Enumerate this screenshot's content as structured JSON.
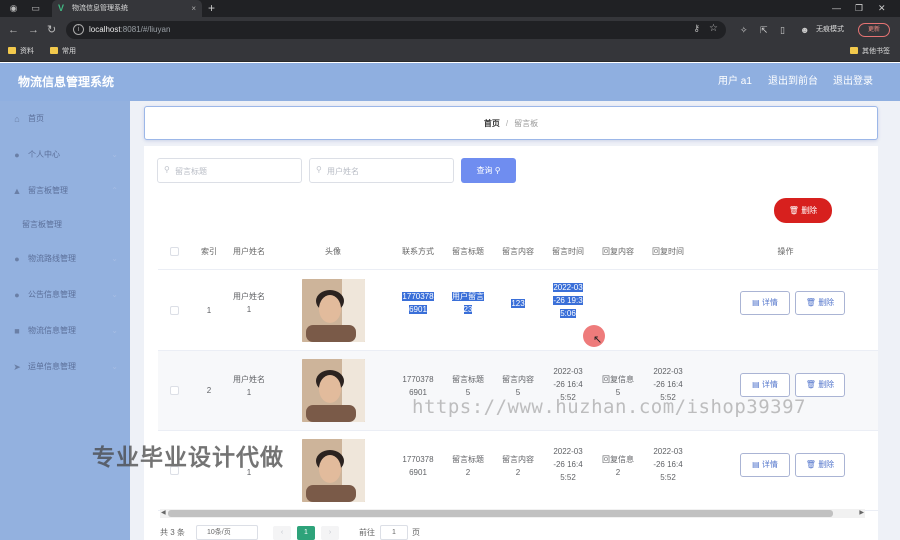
{
  "browser": {
    "tab_title": "物流信息管理系统",
    "tab_close": "×",
    "new_tab": "+",
    "url_host": "localhost",
    "url_rest": ":8081/#/liuyan",
    "incognito_label": "无痕模式",
    "update_label": "更新",
    "bookmarks": [
      "资料",
      "常用"
    ],
    "other_bookmarks": "其他书签"
  },
  "app": {
    "title": "物流信息管理系统",
    "user_label": "用户 a1",
    "back_label": "退出到前台",
    "logout_label": "退出登录"
  },
  "sidebar": {
    "items": [
      {
        "label": "首页",
        "icon": "home-icon"
      },
      {
        "label": "个人中心",
        "icon": "user-icon"
      },
      {
        "label": "留言板管理",
        "icon": "message-icon"
      },
      {
        "label": "留言板管理",
        "icon": ""
      },
      {
        "label": "物流路线管理",
        "icon": "user-icon"
      },
      {
        "label": "公告信息管理",
        "icon": "user-icon"
      },
      {
        "label": "物流信息管理",
        "icon": "box-icon"
      },
      {
        "label": "运单信息管理",
        "icon": "send-icon"
      }
    ]
  },
  "breadcrumb": {
    "home": "首页",
    "separator": "/",
    "current": "留言板"
  },
  "search": {
    "title_placeholder": "留言标题",
    "username_placeholder": "用户姓名",
    "query_label": "查询",
    "delete_label": "删除"
  },
  "table": {
    "headers": [
      "索引",
      "用户姓名",
      "头像",
      "联系方式",
      "留言标题",
      "留言内容",
      "留言时间",
      "回复内容",
      "回复时间",
      "操作"
    ],
    "rows": [
      {
        "index": "1",
        "username": [
          "用户姓名",
          "1"
        ],
        "phone": [
          "1770378",
          "6901"
        ],
        "title": [
          "用户留言",
          "23"
        ],
        "content": [
          "123"
        ],
        "time": [
          "2022-03",
          "-26 19:3",
          "5:06"
        ],
        "reply": [],
        "reply_time": []
      },
      {
        "index": "2",
        "username": [
          "用户姓名",
          "1"
        ],
        "phone": [
          "1770378",
          "6901"
        ],
        "title": [
          "留言标题",
          "5"
        ],
        "content": [
          "留言内容",
          "5"
        ],
        "time": [
          "2022-03",
          "-26 16:4",
          "5:52"
        ],
        "reply": [
          "回复信息",
          "5"
        ],
        "reply_time": [
          "2022-03",
          "-26 16:4",
          "5:52"
        ]
      },
      {
        "index": "",
        "username": [
          "",
          "1"
        ],
        "phone": [
          "1770378",
          "6901"
        ],
        "title": [
          "留言标题",
          "2"
        ],
        "content": [
          "留言内容",
          "2"
        ],
        "time": [
          "2022-03",
          "-26 16:4",
          "5:52"
        ],
        "reply": [
          "回复信息",
          "2"
        ],
        "reply_time": [
          "2022-03",
          "-26 16:4",
          "5:52"
        ]
      }
    ],
    "detail_label": "详情",
    "delete_label": "删除"
  },
  "pagination": {
    "total": "共 3 条",
    "page_size": "10条/页",
    "current_page": "1",
    "goto_label": "前往",
    "goto_value": "1",
    "page_word": "页"
  },
  "watermark": {
    "url": "https://www.huzhan.com/ishop39397",
    "text": "专业毕业设计代做"
  },
  "colors": {
    "header_bg": "#8fafe0",
    "sidebar_bg": "#93b1df",
    "query_button": "#6f8df0",
    "delete_button": "#d7201e",
    "current_page": "#2ea37a"
  }
}
